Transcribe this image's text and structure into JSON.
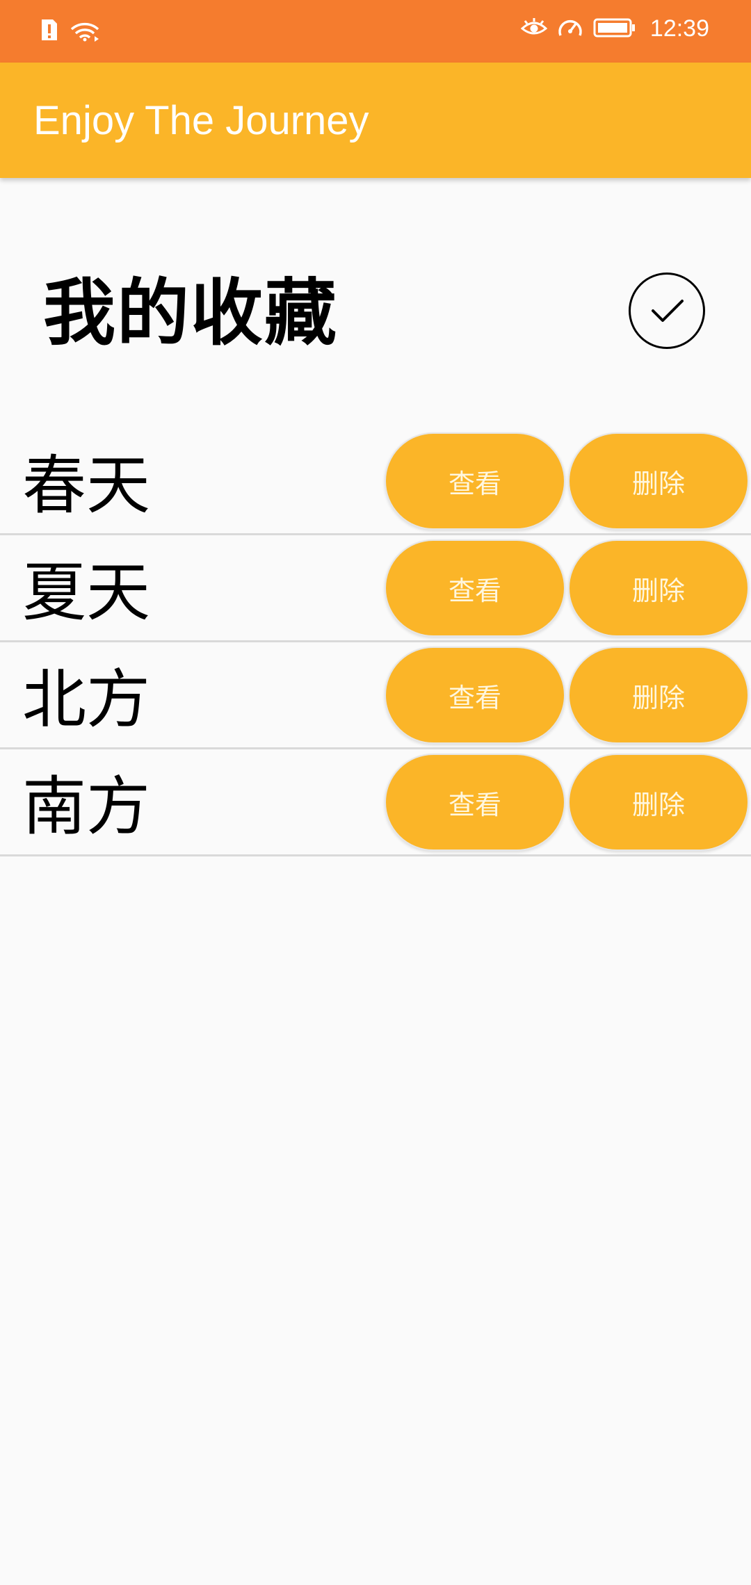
{
  "status_bar": {
    "time": "12:39",
    "icons": [
      "sim-alert-icon",
      "wifi-icon",
      "eye-icon",
      "speed-icon",
      "battery-icon"
    ],
    "background": "#f57c2e"
  },
  "app_bar": {
    "title": "Enjoy The Journey",
    "background": "#fbb528"
  },
  "page": {
    "heading": "我的收藏",
    "confirm_icon": "check-circle-icon"
  },
  "favorites": [
    {
      "title": "春天",
      "view_label": "查看",
      "delete_label": "删除"
    },
    {
      "title": "夏天",
      "view_label": "查看",
      "delete_label": "删除"
    },
    {
      "title": "北方",
      "view_label": "查看",
      "delete_label": "删除"
    },
    {
      "title": "南方",
      "view_label": "查看",
      "delete_label": "删除"
    }
  ],
  "colors": {
    "accent": "#fbb528",
    "divider": "#d9d9d9",
    "background": "#fafafa"
  }
}
